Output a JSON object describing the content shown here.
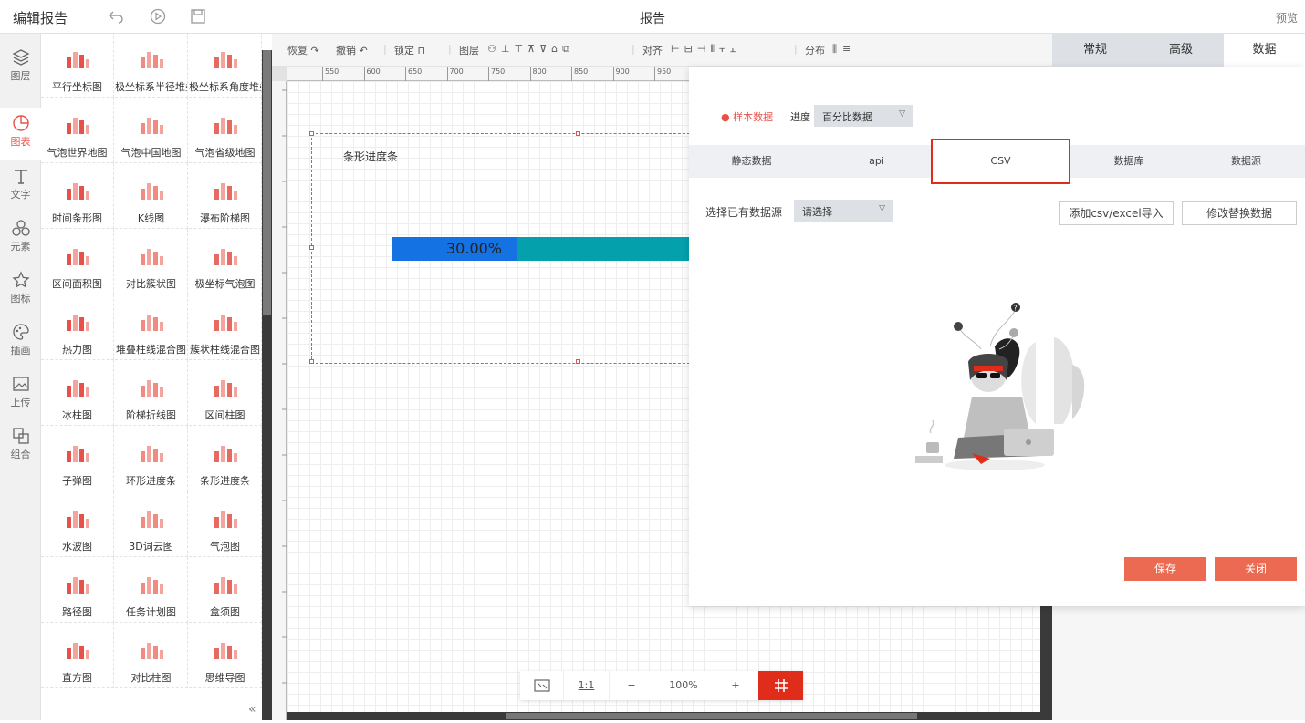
{
  "topbar": {
    "app_title": "编辑报告",
    "doc_title": "报告",
    "preview": "预览"
  },
  "leftnav": [
    {
      "icon": "layers-icon",
      "label": "图层"
    },
    {
      "icon": "pie-chart-icon",
      "label": "图表",
      "active": true
    },
    {
      "icon": "text-icon",
      "label": "文字"
    },
    {
      "icon": "elements-icon",
      "label": "元素"
    },
    {
      "icon": "star-icon",
      "label": "图标"
    },
    {
      "icon": "palette-icon",
      "label": "插画"
    },
    {
      "icon": "upload-image-icon",
      "label": "上传"
    },
    {
      "icon": "group-icon",
      "label": "组合"
    }
  ],
  "palette": [
    "平行坐标图",
    "极坐标系半径堆叠",
    "极坐标系角度堆叠",
    "气泡世界地图",
    "气泡中国地图",
    "气泡省级地图",
    "时间条形图",
    "K线图",
    "瀑布阶梯图",
    "区间面积图",
    "对比簇状图",
    "极坐标气泡图",
    "热力图",
    "堆叠柱线混合图",
    "簇状柱线混合图",
    "冰柱图",
    "阶梯折线图",
    "区间柱图",
    "子弹图",
    "环形进度条",
    "条形进度条",
    "水波图",
    "3D词云图",
    "气泡图",
    "路径图",
    "任务计划图",
    "盒须图",
    "直方图",
    "对比柱图",
    "思维导图"
  ],
  "toolbar": {
    "redo": "恢复",
    "undo": "撤销",
    "lock": "锁定",
    "layer": "图层",
    "align": "对齐",
    "distribute": "分布"
  },
  "ruler_labels": [
    "550",
    "600",
    "650",
    "700",
    "750",
    "800",
    "850",
    "900",
    "950"
  ],
  "widget": {
    "title": "条形进度条",
    "percent_label": "30.00%",
    "progress": 0.3
  },
  "zoom": {
    "ratio": "1:1",
    "minus": "−",
    "level": "100%",
    "plus": "+"
  },
  "right_tabs": [
    "常规",
    "高级",
    "数据"
  ],
  "dialog": {
    "sample_label": "● 样本数据",
    "progress_label": "进度",
    "progress_select": "百分比数据",
    "tabs": [
      "静态数据",
      "api",
      "CSV",
      "数据库",
      "数据源"
    ],
    "active_tab": "CSV",
    "choose_label": "选择已有数据源",
    "choose_placeholder": "请选择",
    "import_button": "添加csv/excel导入",
    "replace_button": "修改替换数据",
    "save_button": "保存",
    "close_button": "关闭"
  },
  "colors": {
    "accent": "#e8504a",
    "progress_fill": "#1572e2",
    "progress_track": "#04a0ac",
    "highlight": "#e02d1b"
  }
}
